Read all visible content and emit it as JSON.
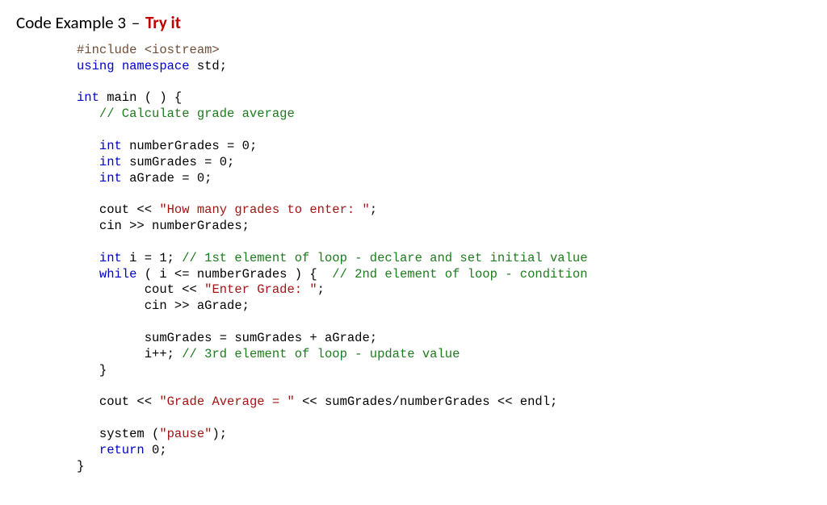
{
  "heading": {
    "label": "Code Example 3",
    "dash": "–",
    "tryit": "Try it"
  },
  "code": {
    "pp_include": "#include",
    "iostream": " <iostream>",
    "kw_using": "using",
    "kw_namespace": " namespace",
    "std_line": " std;",
    "kw_int1": "int",
    "main_sig": " main ( ) {",
    "cmt_calc": "// Calculate grade average",
    "kw_int2": "int",
    "decl_numGrades": " numberGrades = 0;",
    "kw_int3": "int",
    "decl_sumGrades": " sumGrades = 0;",
    "kw_int4": "int",
    "decl_aGrade": " aGrade = 0;",
    "cout1_pre": "cout << ",
    "cout1_str": "\"How many grades to enter: \"",
    "cout1_post": ";",
    "cin1": "cin >> numberGrades;",
    "kw_int5": "int",
    "i_decl": " i = 1; ",
    "cmt_1st": "// 1st element of loop - declare and set initial value",
    "kw_while": "while",
    "while_cond": " ( i <= numberGrades ) {  ",
    "cmt_2nd": "// 2nd element of loop - condition",
    "cout2_pre": "cout << ",
    "cout2_str": "\"Enter Grade: \"",
    "cout2_post": ";",
    "cin2": "cin >> aGrade;",
    "sum_line": "sumGrades = sumGrades + aGrade;",
    "ipp": "i++; ",
    "cmt_3rd": "// 3rd element of loop - update value",
    "close_while": "}",
    "cout3_pre": "cout << ",
    "cout3_str": "\"Grade Average = \"",
    "cout3_post": " << sumGrades/numberGrades << endl;",
    "sys_pre": "system (",
    "sys_str": "\"pause\"",
    "sys_post": ");",
    "kw_return": "return",
    "return_tail": " 0;",
    "close_main": "}"
  }
}
